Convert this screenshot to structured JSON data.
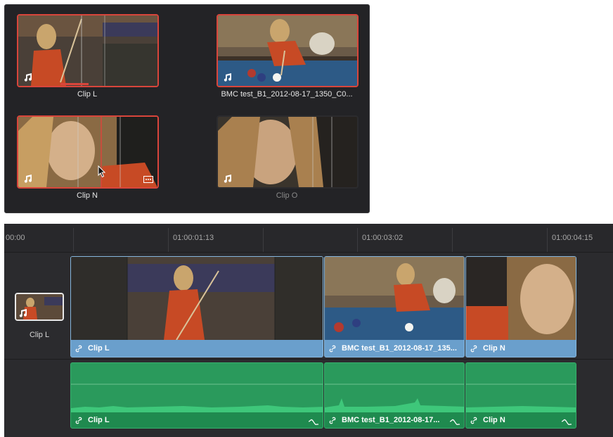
{
  "media_pool": {
    "clips": [
      {
        "label": "Clip L",
        "selected": true,
        "icon": "music-note-icon"
      },
      {
        "label": "BMC test_B1_2012-08-17_1350_C0...",
        "selected": true,
        "icon": "music-note-icon"
      },
      {
        "label": "Clip N",
        "selected": true,
        "icon": "music-note-icon",
        "badge_icon": "ellipsis-icon"
      },
      {
        "label": "Clip O",
        "selected": false,
        "icon": "music-note-icon"
      }
    ]
  },
  "timeline": {
    "timecodes": [
      "00:00",
      "01:00:01:13",
      "01:00:03:02",
      "01:00:04:15"
    ],
    "track_header": {
      "label": "Clip L"
    },
    "video_clips": [
      {
        "label": "Clip L",
        "icon": "link-icon"
      },
      {
        "label": "BMC test_B1_2012-08-17_135...",
        "icon": "link-icon"
      },
      {
        "label": "Clip N",
        "icon": "link-icon"
      }
    ],
    "audio_clips": [
      {
        "label": "Clip L",
        "icon": "link-icon"
      },
      {
        "label": "BMC test_B1_2012-08-17...",
        "icon": "link-icon"
      },
      {
        "label": "Clip N",
        "icon": "link-icon"
      }
    ]
  },
  "colors": {
    "selection_border": "#d9453b",
    "video_clip": "#6a9fcc",
    "audio_clip": "#2a9a5c",
    "panel_bg": "#232326"
  }
}
